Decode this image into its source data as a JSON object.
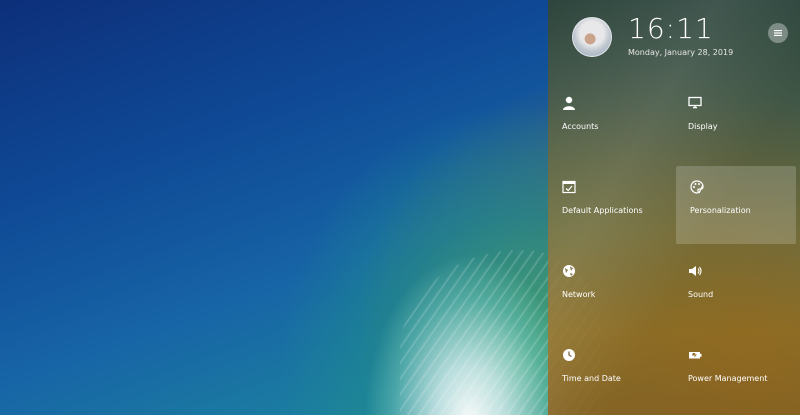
{
  "header": {
    "time": "16:11",
    "date": "Monday, January 28, 2019"
  },
  "tiles": [
    {
      "label": "Accounts",
      "icon": "user-icon"
    },
    {
      "label": "Display",
      "icon": "monitor-icon"
    },
    {
      "label": "Default Applications",
      "icon": "window-check-icon"
    },
    {
      "label": "Personalization",
      "icon": "palette-icon"
    },
    {
      "label": "Network",
      "icon": "globe-icon"
    },
    {
      "label": "Sound",
      "icon": "speaker-icon"
    },
    {
      "label": "Time and Date",
      "icon": "clock-icon"
    },
    {
      "label": "Power Management",
      "icon": "battery-icon"
    }
  ],
  "selected_tile": "Personalization"
}
